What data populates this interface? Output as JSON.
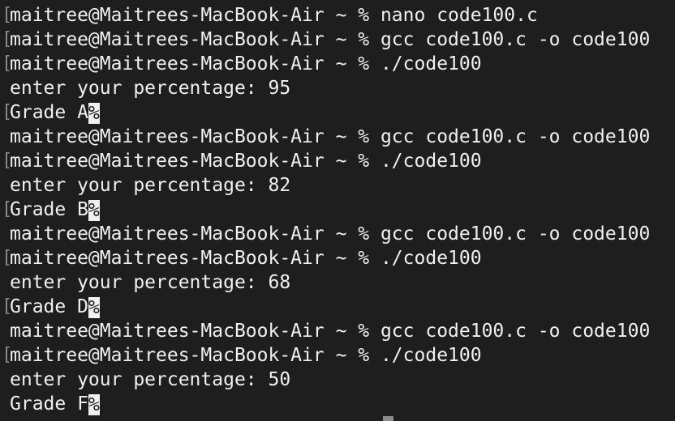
{
  "terminal": {
    "lines": [
      {
        "text": "maitree@Maitrees-MacBook-Air ~ % nano code100.c",
        "marked": true
      },
      {
        "text": "maitree@Maitrees-MacBook-Air ~ % gcc code100.c -o code100",
        "marked": true
      },
      {
        "text": "maitree@Maitrees-MacBook-Air ~ % ./code100",
        "marked": true
      },
      {
        "text": "enter your percentage: 95",
        "marked": false
      },
      {
        "text": "Grade A",
        "marked": true,
        "eol": "%"
      },
      {
        "text": "maitree@Maitrees-MacBook-Air ~ % gcc code100.c -o code100",
        "marked": false
      },
      {
        "text": "maitree@Maitrees-MacBook-Air ~ % ./code100",
        "marked": true
      },
      {
        "text": "enter your percentage: 82",
        "marked": false
      },
      {
        "text": "Grade B",
        "marked": true,
        "eol": "%"
      },
      {
        "text": "maitree@Maitrees-MacBook-Air ~ % gcc code100.c -o code100",
        "marked": false
      },
      {
        "text": "maitree@Maitrees-MacBook-Air ~ % ./code100",
        "marked": true
      },
      {
        "text": "enter your percentage: 68",
        "marked": false
      },
      {
        "text": "Grade D",
        "marked": true,
        "eol": "%"
      },
      {
        "text": "maitree@Maitrees-MacBook-Air ~ % gcc code100.c -o code100",
        "marked": false
      },
      {
        "text": "maitree@Maitrees-MacBook-Air ~ % ./code100",
        "marked": true
      },
      {
        "text": "enter your percentage: 50",
        "marked": false
      },
      {
        "text": "Grade F",
        "marked": false,
        "eol": "%"
      }
    ],
    "mark_glyph": "["
  },
  "colors": {
    "background": "#1e1e1e",
    "foreground": "#f0f0f0",
    "mark": "#8a8a8a",
    "cursor": "#8c8c8c"
  }
}
